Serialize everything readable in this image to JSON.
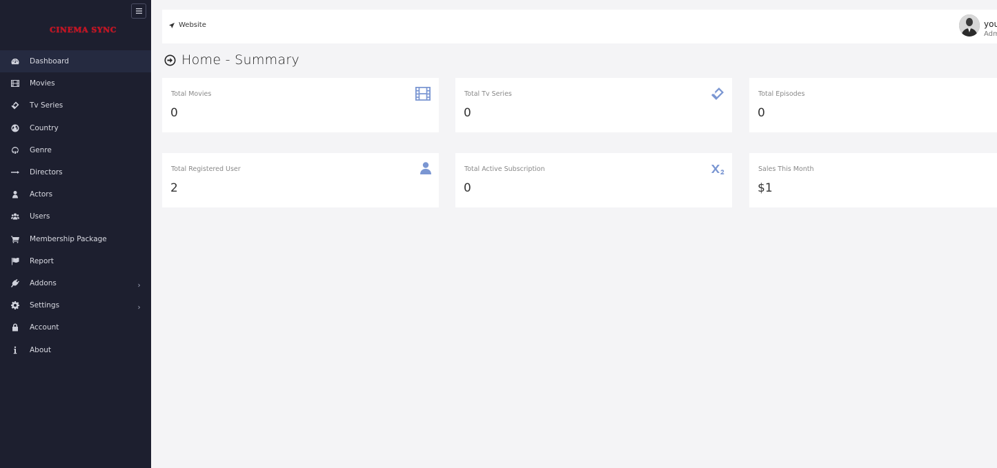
{
  "brand": {
    "logo_text": "CINEMA SYNC"
  },
  "sidebar": {
    "items": [
      {
        "label": "Dashboard",
        "icon": "dashboard-icon",
        "active": true
      },
      {
        "label": "Movies",
        "icon": "film-icon"
      },
      {
        "label": "Tv Series",
        "icon": "ticket-icon"
      },
      {
        "label": "Country",
        "icon": "globe-icon"
      },
      {
        "label": "Genre",
        "icon": "genre-icon"
      },
      {
        "label": "Directors",
        "icon": "arrow-right-icon"
      },
      {
        "label": "Actors",
        "icon": "user-icon"
      },
      {
        "label": "Users",
        "icon": "users-icon"
      },
      {
        "label": "Membership Package",
        "icon": "cart-icon"
      },
      {
        "label": "Report",
        "icon": "flag-icon"
      },
      {
        "label": "Addons",
        "icon": "plug-icon",
        "has_children": true
      },
      {
        "label": "Settings",
        "icon": "gear-icon",
        "has_children": true
      },
      {
        "label": "Account",
        "icon": "lock-icon"
      },
      {
        "label": "About",
        "icon": "info-icon"
      }
    ]
  },
  "topbar": {
    "website_label": "Website",
    "user_name": "you",
    "user_role": "Adm"
  },
  "page": {
    "title": "Home - Summary"
  },
  "cards": [
    {
      "label": "Total Movies",
      "value": "0",
      "icon": "film-icon"
    },
    {
      "label": "Total Tv Series",
      "value": "0",
      "icon": "ticket-icon"
    },
    {
      "label": "Total Episodes",
      "value": "0",
      "icon": ""
    },
    {
      "label": "Total Registered User",
      "value": "2",
      "icon": "user-icon"
    },
    {
      "label": "Total Active Subscription",
      "value": "0",
      "icon": "subscript-icon"
    },
    {
      "label": "Sales This Month",
      "value": "$1",
      "icon": ""
    }
  ],
  "colors": {
    "sidebar_bg": "#1d1f2f",
    "sidebar_active_bg": "#252a40",
    "card_icon": "#7a96d2",
    "logo": "#c8101e",
    "page_bg": "#f4f4f6"
  }
}
